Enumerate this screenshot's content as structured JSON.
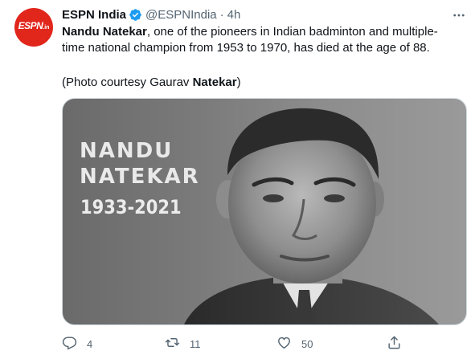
{
  "tweet": {
    "avatar_text": "ESPN",
    "avatar_suffix": ".in",
    "author_name": "ESPN India",
    "handle": "@ESPNIndia",
    "separator": "·",
    "time": "4h",
    "text_name": "Nandu Natekar",
    "text_rest": ", one of the pioneers in Indian badminton and multiple-time national champion from 1953 to 1970, has died at the age of 88.",
    "credit_prefix": "(Photo courtesy Gaurav ",
    "credit_bold": "Natekar",
    "credit_suffix": ")"
  },
  "media": {
    "first_name": "NANDU",
    "last_name": "NATEKAR",
    "years": "1933-2021"
  },
  "actions": {
    "replies": "4",
    "retweets": "11",
    "likes": "50"
  },
  "icons": {
    "verified": "verified-badge-icon",
    "more": "more-options-icon",
    "reply": "reply-icon",
    "retweet": "retweet-icon",
    "like": "heart-icon",
    "share": "share-icon"
  },
  "colors": {
    "brand": "#e1261c",
    "verified": "#1d9bf0",
    "secondary_text": "#536471"
  }
}
